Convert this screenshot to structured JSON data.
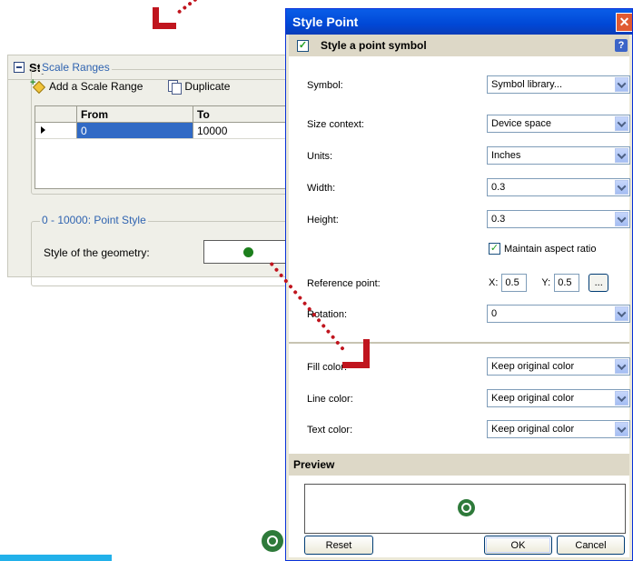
{
  "background_panel": {
    "title": "Style",
    "scale_ranges_legend": "Scale Ranges",
    "toolbar": {
      "add_label": "Add a Scale Range",
      "duplicate_label": "Duplicate"
    },
    "grid": {
      "headers": [
        "",
        "From",
        "To"
      ],
      "rows": [
        {
          "from": "0",
          "to": "10000"
        }
      ]
    },
    "point_style_legend": "0 - 10000: Point Style",
    "geometry_label": "Style of the geometry:"
  },
  "dialog": {
    "title": "Style Point",
    "close_glyph": "✕",
    "section_title": "Style a point symbol",
    "section_checked": true,
    "help_glyph": "?",
    "fields": {
      "symbol": {
        "label": "Symbol:",
        "value": "Symbol library..."
      },
      "size_context": {
        "label": "Size context:",
        "value": "Device space"
      },
      "units": {
        "label": "Units:",
        "value": "Inches"
      },
      "width": {
        "label": "Width:",
        "value": "0.3"
      },
      "height": {
        "label": "Height:",
        "value": "0.3"
      },
      "maintain_aspect": {
        "label": "Maintain aspect ratio",
        "checked": true
      },
      "reference_point": {
        "label": "Reference point:",
        "x_label": "X:",
        "x_value": "0.5",
        "y_label": "Y:",
        "y_value": "0.5",
        "button": "..."
      },
      "rotation": {
        "label": "Rotation:",
        "value": "0"
      },
      "fill_color": {
        "label": "Fill color:",
        "value": "Keep original color"
      },
      "line_color": {
        "label": "Line color:",
        "value": "Keep original color"
      },
      "text_color": {
        "label": "Text color:",
        "value": "Keep original color"
      }
    },
    "preview_title": "Preview",
    "buttons": {
      "reset": "Reset",
      "ok": "OK",
      "cancel": "Cancel"
    }
  },
  "colors": {
    "titlebar": "#0054e3",
    "selection": "#316ac5",
    "callout": "#c0151e",
    "accent_bar": "#22b1ea"
  }
}
